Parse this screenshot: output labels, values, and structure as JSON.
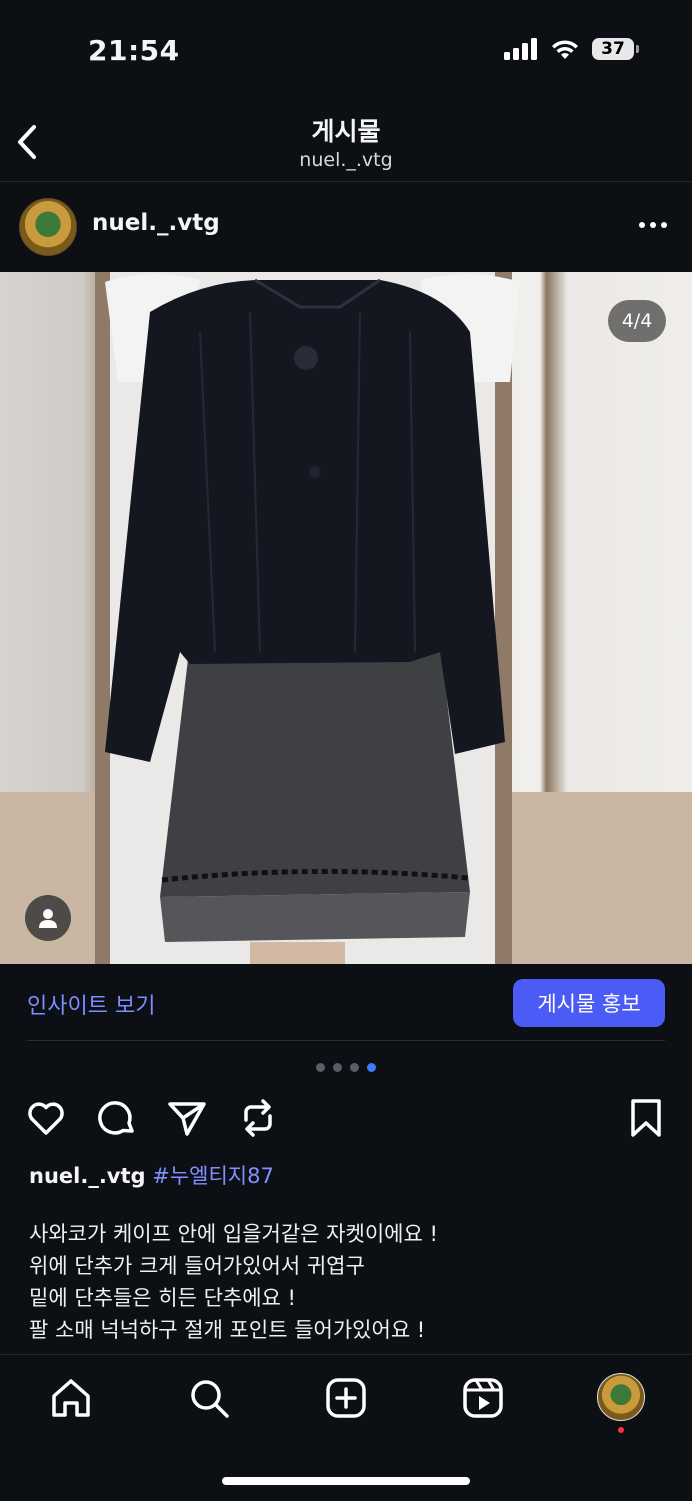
{
  "status": {
    "time": "21:54",
    "battery": "37"
  },
  "header": {
    "title": "게시물",
    "subtitle": "nuel._.vtg"
  },
  "post": {
    "username": "nuel._.vtg",
    "image_counter": "4/4",
    "carousel": {
      "count": 4,
      "active_index": 3
    }
  },
  "insights": {
    "view_label": "인사이트 보기",
    "promote_label": "게시물 홍보"
  },
  "caption": {
    "username": "nuel._.vtg",
    "hashtag": "#누엘티지87",
    "lines": [
      "사와코가 케이프 안에 입을거같은 자켓이에요 !",
      "위에 단추가 크게 들어가있어서 귀엽구",
      "밑에 단추들은 히든 단추에요 !",
      "팔 소매 넉넉하구 절개 포인트 들어가있어요 !"
    ]
  },
  "icons": {
    "back": "chevron-left-icon",
    "more": "more-horizontal-icon",
    "like": "heart-icon",
    "comment": "comment-icon",
    "share": "send-icon",
    "repost": "repost-icon",
    "save": "bookmark-icon",
    "tag_people": "person-icon",
    "nav": [
      "home-icon",
      "search-icon",
      "create-icon",
      "reels-icon",
      "profile-avatar"
    ]
  },
  "colors": {
    "accent": "#4a5cf5",
    "link": "#7d8cff",
    "carousel_active": "#3d7bf7",
    "background": "#0c0f14"
  }
}
